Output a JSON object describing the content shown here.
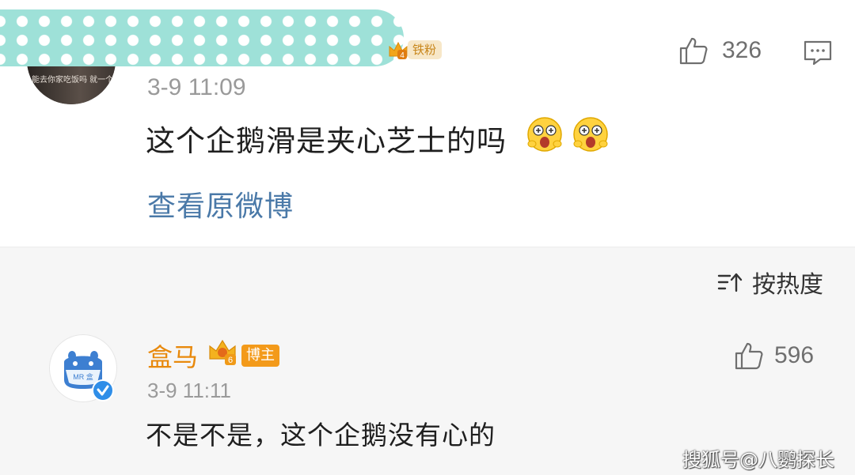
{
  "comment1": {
    "fan_badge": "铁粉",
    "fan_level": "4",
    "avatar_text": "能去你家吃饭吗 就一个",
    "time": "3-9 11:09",
    "content": "这个企鹅滑是夹心芝士的吗",
    "emoji": "eyes-shocked-emoji",
    "view_original": "查看原微博",
    "likes": "326"
  },
  "sort": {
    "label": "按热度",
    "icon": "sort-icon"
  },
  "comment2": {
    "name": "盒马",
    "crown_level": "6",
    "owner_badge": "博主",
    "avatar_text": "MR 盒",
    "time": "3-9 11:11",
    "content": "不是不是，这个企鹅没有心的",
    "likes": "596"
  },
  "watermark": "搜狐号@八鹦探长",
  "colors": {
    "link": "#4a79a8",
    "name": "#e8890c",
    "badge_bg": "#f39a1a",
    "mask": "#9ee1d8",
    "verified": "#2f8ee8"
  }
}
